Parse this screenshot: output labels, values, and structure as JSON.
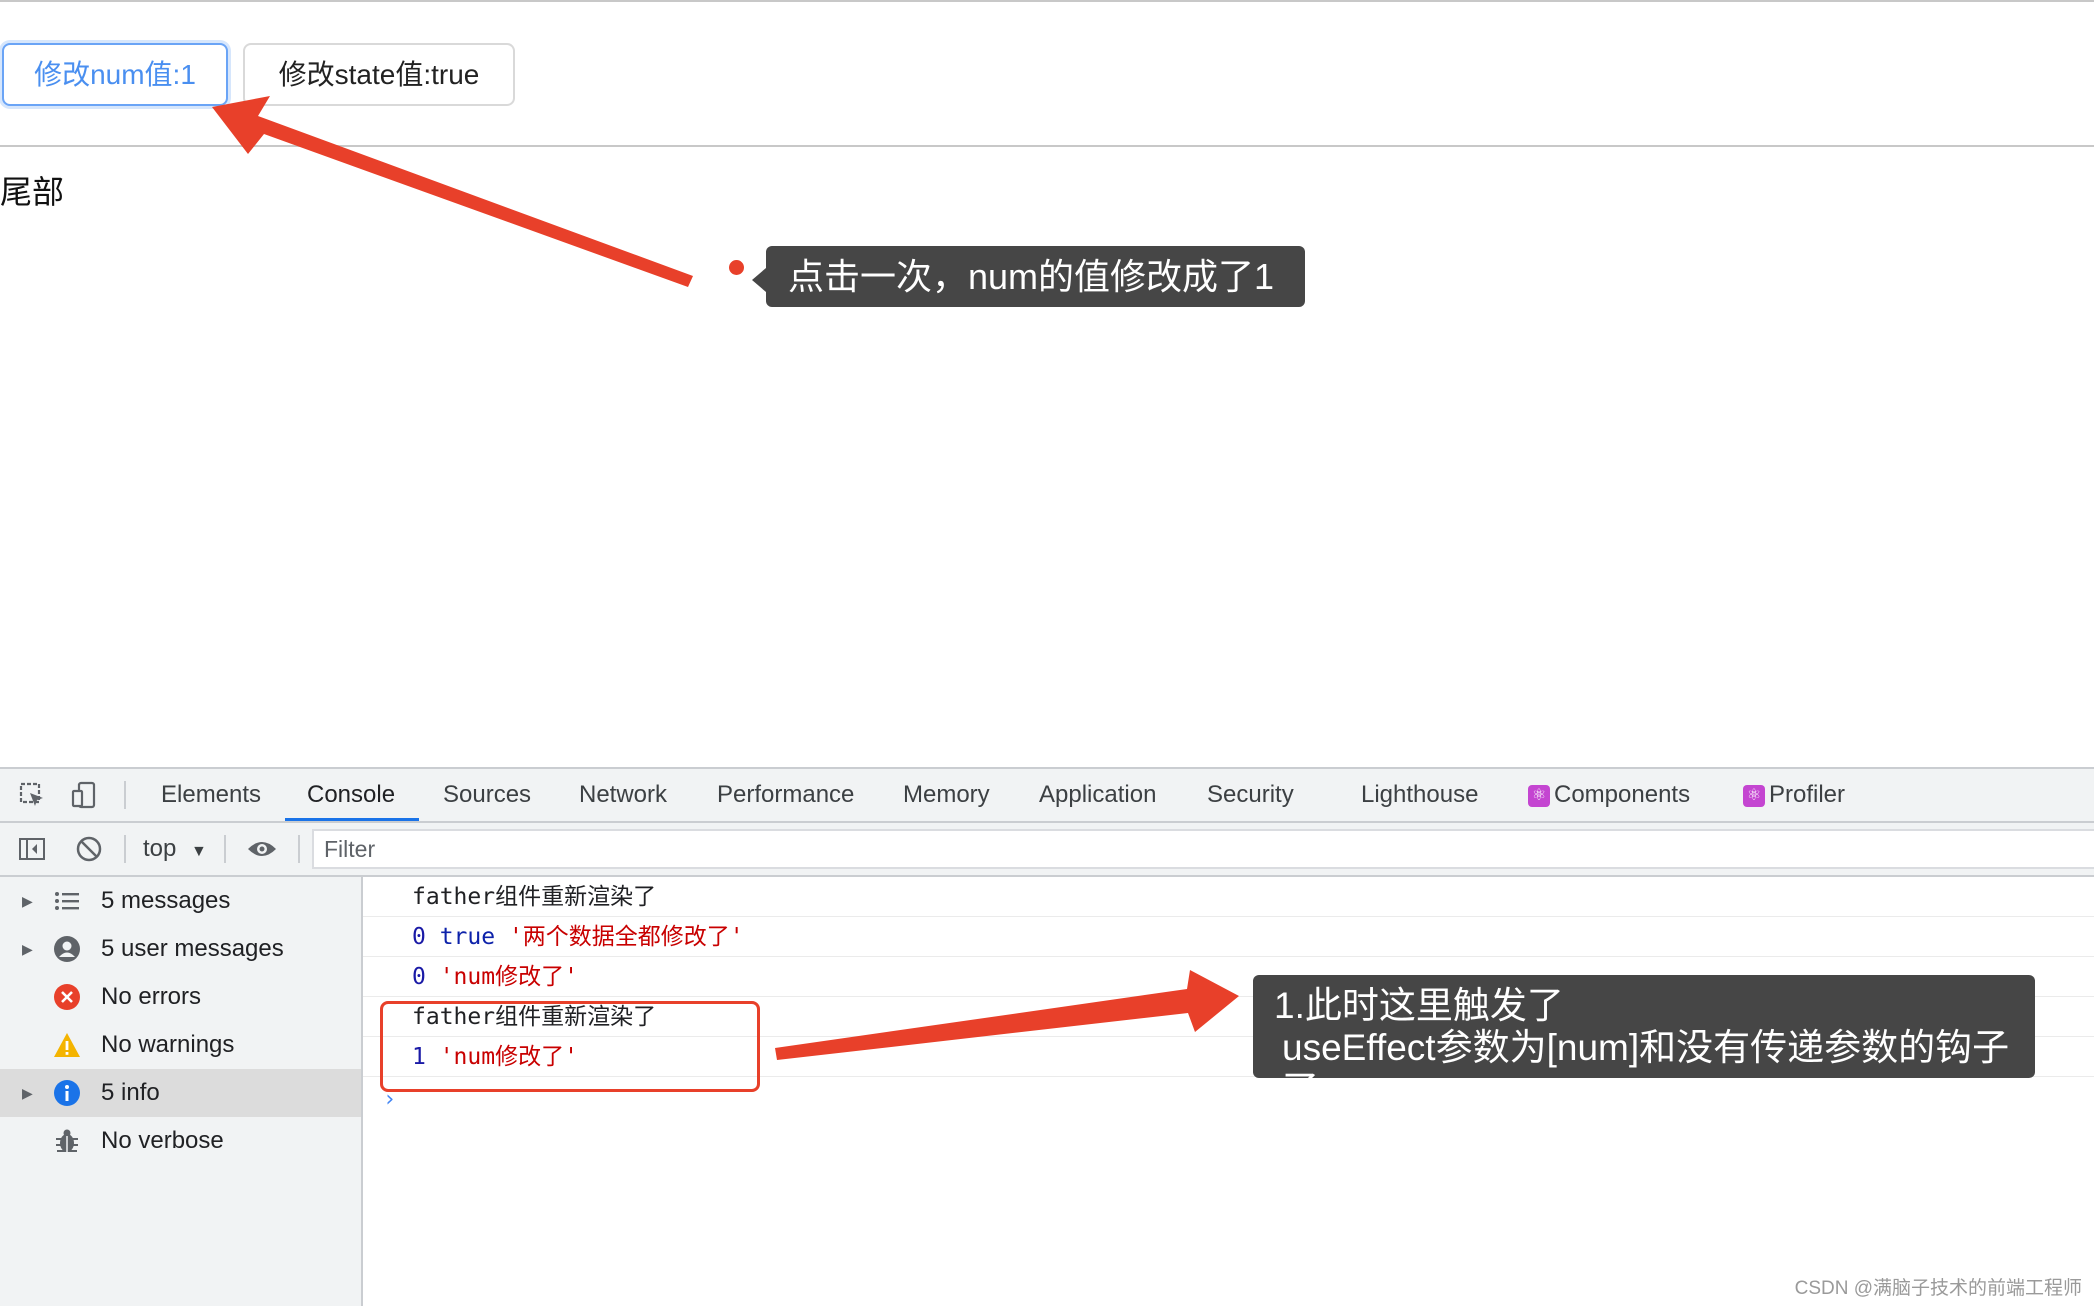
{
  "page": {
    "buttons": {
      "num": "修改num值:1",
      "state": "修改state值:true"
    },
    "footer": "尾部"
  },
  "annotations": {
    "tip1": "点击一次，num的值修改成了1",
    "tip2_line1": "1.此时这里触发了",
    "tip2_line2": "useEffect参数为[num]和没有传递参数的钩子",
    "tip2_line3": "了",
    "accent": "#e8402a"
  },
  "devtools": {
    "tabs": [
      "Elements",
      "Console",
      "Sources",
      "Network",
      "Performance",
      "Memory",
      "Application",
      "Security",
      "Lighthouse",
      "Components",
      "Profiler"
    ],
    "active_tab": "Console",
    "context": "top",
    "filter_placeholder": "Filter",
    "sidebar": [
      {
        "label": "5 messages",
        "icon": "list-icon"
      },
      {
        "label": "5 user messages",
        "icon": "user-icon"
      },
      {
        "label": "No errors",
        "icon": "error-icon"
      },
      {
        "label": "No warnings",
        "icon": "warning-icon"
      },
      {
        "label": "5 info",
        "icon": "info-icon"
      },
      {
        "label": "No verbose",
        "icon": "bug-icon"
      }
    ],
    "console_lines": [
      {
        "parts": [
          {
            "t": "father组件重新渲染了",
            "c": "plain"
          }
        ]
      },
      {
        "parts": [
          {
            "t": "0",
            "c": "num"
          },
          {
            "t": " true",
            "c": "bool"
          },
          {
            "t": " '两个数据全都修改了'",
            "c": "str"
          }
        ]
      },
      {
        "parts": [
          {
            "t": "0",
            "c": "num"
          },
          {
            "t": " 'num修改了'",
            "c": "str"
          }
        ]
      },
      {
        "parts": [
          {
            "t": "father组件重新渲染了",
            "c": "plain"
          }
        ]
      },
      {
        "parts": [
          {
            "t": "1",
            "c": "num"
          },
          {
            "t": " 'num修改了'",
            "c": "str"
          }
        ]
      }
    ]
  },
  "watermark": "CSDN @满脑子技术的前端工程师"
}
